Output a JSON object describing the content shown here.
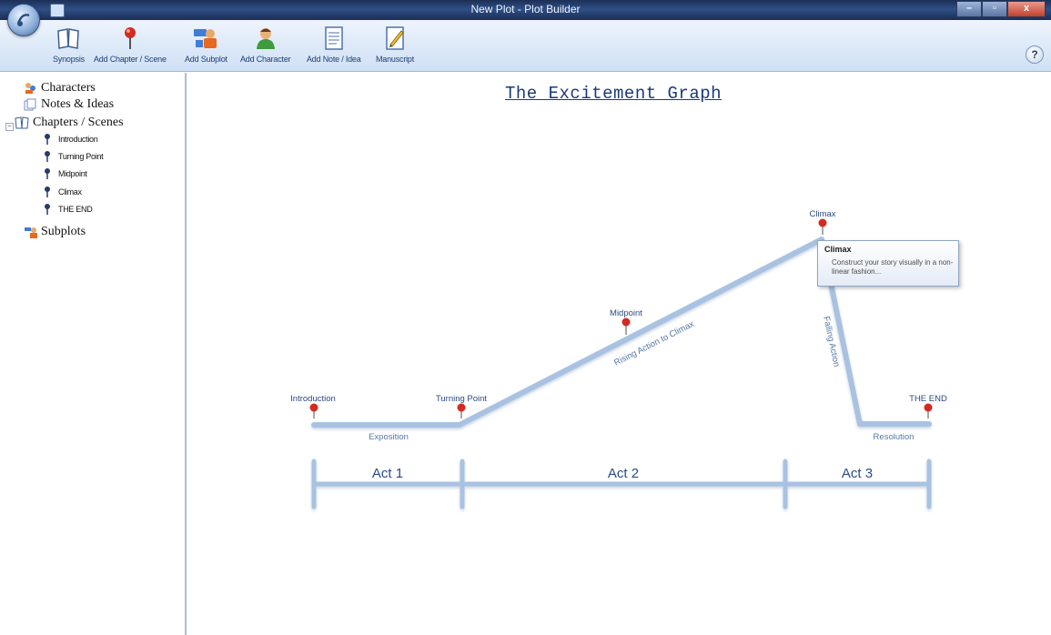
{
  "window": {
    "title": "New Plot - Plot Builder"
  },
  "toolbar": {
    "buttons": [
      {
        "label": "Synopsis",
        "icon": "book-icon"
      },
      {
        "label": "Add Chapter / Scene",
        "icon": "pushpin-icon"
      },
      {
        "label": "Add Subplot",
        "icon": "subplot-icon"
      },
      {
        "label": "Add Character",
        "icon": "character-icon"
      },
      {
        "label": "Add Note / Idea",
        "icon": "note-icon"
      },
      {
        "label": "Manuscript",
        "icon": "pencil-document-icon"
      }
    ],
    "help": "?"
  },
  "sidebar": {
    "characters": "Characters",
    "notes": "Notes & Ideas",
    "chapters": "Chapters / Scenes",
    "scenes": [
      "Introduction",
      "Turning Point",
      "Midpoint",
      "Climax",
      "THE END"
    ],
    "subplots": "Subplots"
  },
  "graph": {
    "title": "The Excitement Graph",
    "pins": [
      "Introduction",
      "Turning Point",
      "Midpoint",
      "Climax",
      "THE END"
    ],
    "segments": [
      "Exposition",
      "Rising Action to Climax",
      "Falling Action",
      "Resolution"
    ],
    "acts": [
      "Act 1",
      "Act 2",
      "Act 3"
    ],
    "line_color": "#a9c2e2",
    "pin_color": "#d42a20"
  },
  "tooltip": {
    "title": "Climax",
    "body": "Construct your story visually in a non-linear fashion..."
  }
}
